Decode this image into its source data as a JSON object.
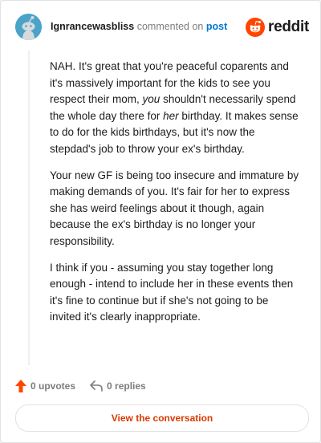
{
  "header": {
    "username": "Ignrancewasbliss",
    "action_text": "commented on",
    "target_link": "post",
    "brand": "reddit"
  },
  "comment": {
    "paragraphs": [
      {
        "p1": "NAH. It's great that you're peaceful coparents and it's massively important for the kids to see you respect their mom, ",
        "em1": "you",
        "p2": " shouldn't necessarily spend the whole day there for ",
        "em2": "her",
        "p3": " birthday. It makes sense to do for the kids birthdays, but it's now the stepdad's job to throw your ex's birthday."
      },
      "Your new GF is being too insecure and immature by making demands of you. It's fair for her to express she has weird feelings about it though, again because the ex's birthday is no longer your responsibility.",
      "I think if you - assuming you stay together long enough - intend to include her in these events then it's fine to continue but if she's not going to be invited it's clearly inappropriate."
    ]
  },
  "actions": {
    "upvotes": "0 upvotes",
    "replies": "0 replies"
  },
  "cta": {
    "label": "View the conversation"
  },
  "colors": {
    "brand_orange": "#ff4500",
    "link_blue": "#0079d3",
    "cta_text": "#d93a00",
    "avatar_bg": "#4aa3c9"
  }
}
